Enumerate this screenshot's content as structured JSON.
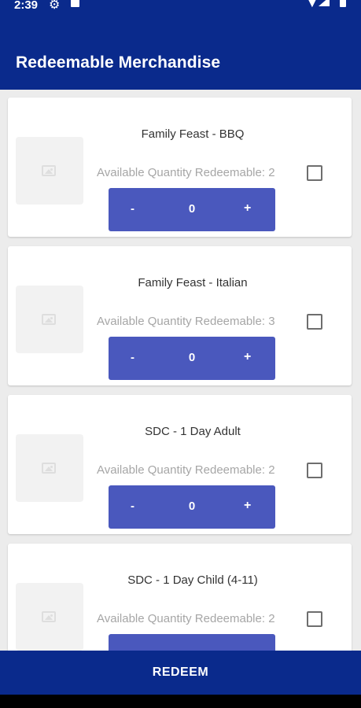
{
  "status_bar": {
    "time": "2:39"
  },
  "app_bar": {
    "title": "Redeemable Merchandise"
  },
  "items": [
    {
      "name": "Family Feast - BBQ",
      "available": "Available Quantity Redeemable: 2",
      "quantity": "0",
      "minus": "-",
      "plus": "+"
    },
    {
      "name": "Family Feast - Italian",
      "available": "Available Quantity Redeemable: 3",
      "quantity": "0",
      "minus": "-",
      "plus": "+"
    },
    {
      "name": "SDC - 1 Day Adult",
      "available": "Available Quantity Redeemable: 2",
      "quantity": "0",
      "minus": "-",
      "plus": "+"
    },
    {
      "name": "SDC - 1 Day Child (4-11)",
      "available": "Available Quantity Redeemable: 2"
    }
  ],
  "footer": {
    "redeem_label": "REDEEM"
  },
  "colors": {
    "primary": "#0a2a8c",
    "stepper": "#4a58bd",
    "background": "#ececec"
  },
  "icons": [
    "gear-icon",
    "sd-card-icon",
    "wifi-icon",
    "signal-icon",
    "battery-icon",
    "image-placeholder-icon"
  ]
}
